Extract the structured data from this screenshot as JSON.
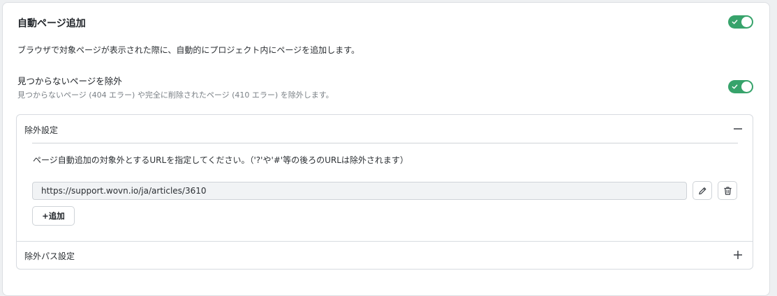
{
  "section": {
    "title": "自動ページ追加",
    "description": "ブラウザで対象ページが表示された際に、自動的にプロジェクト内にページを追加します。",
    "enabled": true
  },
  "exclude_not_found": {
    "title": "見つからないページを除外",
    "description": "見つからないページ (404 エラー) や完全に削除されたページ (410 エラー) を除外します。",
    "enabled": true
  },
  "exclusion_settings": {
    "label": "除外設定",
    "expanded": true,
    "instruction": "ページ自動追加の対象外とするURLを指定してください。（'?'や'#'等の後ろのURLは除外されます）",
    "urls": [
      "https://support.wovn.io/ja/articles/3610"
    ],
    "add_label": "+追加"
  },
  "exclusion_path_settings": {
    "label": "除外パス設定",
    "expanded": false
  },
  "colors": {
    "toggle_on": "#37a36b"
  }
}
